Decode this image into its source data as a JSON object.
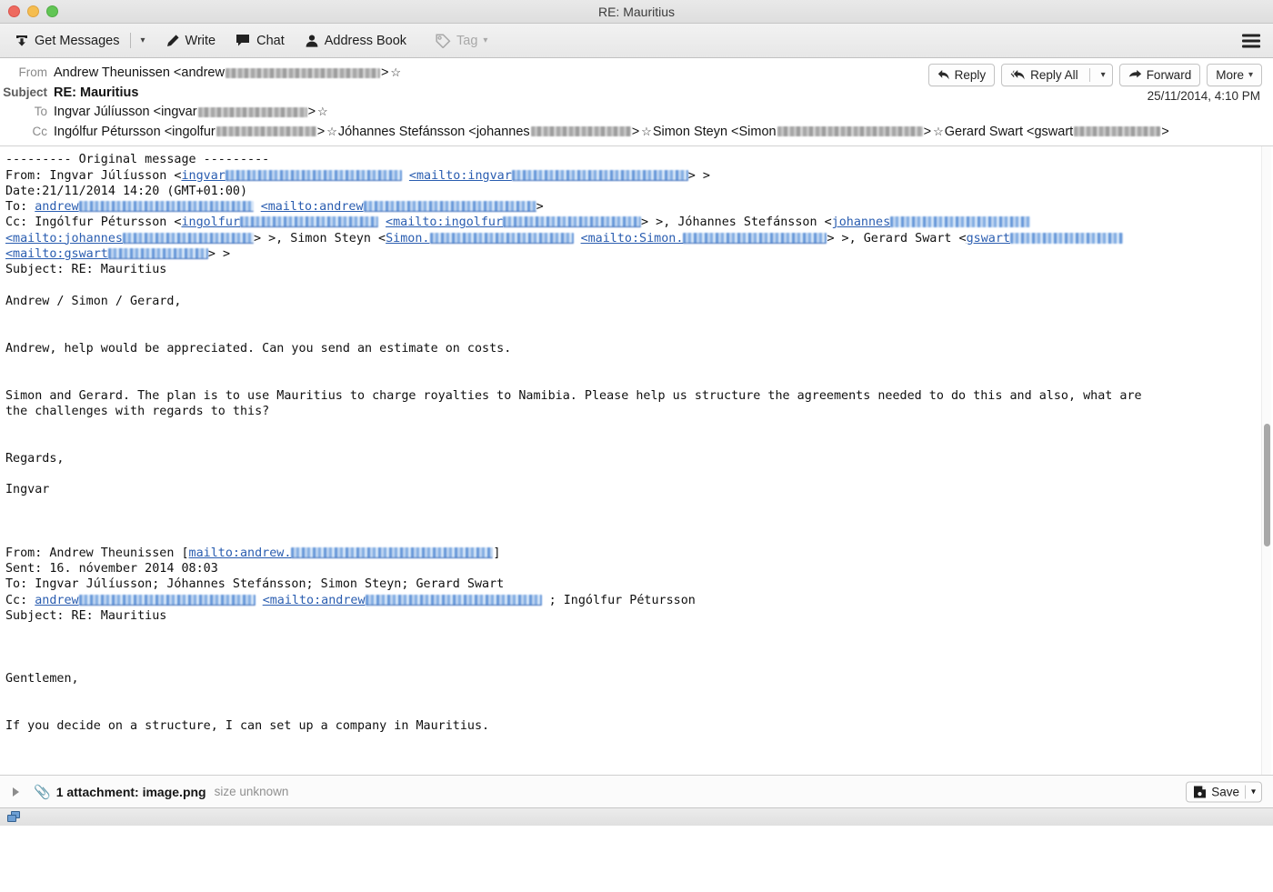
{
  "window": {
    "title": "RE: Mauritius",
    "traffic_lights": [
      "close",
      "minimize",
      "zoom"
    ]
  },
  "toolbar": {
    "get_messages": "Get Messages",
    "write": "Write",
    "chat": "Chat",
    "address_book": "Address Book",
    "tag": "Tag",
    "menu": "app-menu"
  },
  "message_header": {
    "from_label": "From",
    "from_value": "Andrew Theunissen <andrew",
    "from_value_end": ">",
    "subject_label": "Subject",
    "subject_value": "RE: Mauritius",
    "to_label": "To",
    "to_value": "Ingvar Júlíusson <ingvar",
    "to_value_end": ">",
    "cc_label": "Cc",
    "cc_parts": [
      {
        "name": "Ingólfur Pétursson <ingolfur",
        "end": ">"
      },
      {
        "name": "Jóhannes Stefánsson <johannes",
        "end": ">"
      },
      {
        "name": "Simon Steyn <Simon",
        "end": ">"
      },
      {
        "name": "Gerard Swart <gswart",
        "end": ">"
      }
    ],
    "timestamp": "25/11/2014, 4:10 PM"
  },
  "actions": {
    "reply": "Reply",
    "reply_all": "Reply All",
    "forward": "Forward",
    "more": "More"
  },
  "body": {
    "separator_line": "--------- Original message ---------",
    "quote1": {
      "from_prefix": "From: Ingvar Júlíusson <",
      "from_link1": "ingvar",
      "from_link2": "<mailto:ingvar",
      "from_suffix": "> >",
      "date": "Date:21/11/2014 14:20 (GMT+01:00)",
      "to_prefix": "To: ",
      "to_link1": "andrew",
      "to_link2": "<mailto:andrew",
      "to_suffix": ">",
      "cc_prefix": "Cc: Ingólfur Pétursson <",
      "cc_link1": "ingolfur",
      "cc_link2": "<mailto:ingolfur",
      "cc_mid1": "> >, Jóhannes Stefánsson <",
      "cc_link3": "johannes",
      "cc_link4": "<mailto:johannes",
      "cc_mid2": "> >, Simon Steyn <",
      "cc_link5": "Simon.",
      "cc_link6": "<mailto:Simon.",
      "cc_mid3": "> >, Gerard Swart <",
      "cc_link7": "gswart",
      "cc_link8": "<mailto:gswart",
      "cc_suffix": "> >",
      "subject": "Subject: RE: Mauritius",
      "greeting": "Andrew / Simon / Gerard,",
      "para1": "Andrew, help would be appreciated. Can you send an estimate on costs.",
      "para2_line1": "Simon and Gerard. The plan is to use Mauritius to charge royalties to Namibia. Please help us structure the agreements needed to do this and also, what are",
      "para2_line2": "the challenges with regards to this?",
      "signoff": "Regards,",
      "signature": "Ingvar"
    },
    "quote2": {
      "from_prefix": "From: Andrew Theunissen [",
      "from_link": "mailto:andrew.",
      "from_suffix": "]",
      "sent": "Sent: 16. nóvember 2014 08:03",
      "to": "To: Ingvar Júlíusson; Jóhannes Stefánsson; Simon Steyn; Gerard Swart",
      "cc_prefix": "Cc: ",
      "cc_link1": "andrew",
      "cc_link2": "<mailto:andrew",
      "cc_suffix": "; Ingólfur Pétursson",
      "subject": "Subject: RE: Mauritius",
      "greeting": "Gentlemen,",
      "para1": "If you decide on a structure, I can set up a company in Mauritius."
    }
  },
  "attachment_bar": {
    "twisty": "expand-triangle",
    "label": "1 attachment: image.png",
    "size": "size unknown",
    "save_label": "Save"
  },
  "status_bar": {
    "indicator": "network-activity-icon"
  },
  "colors": {
    "link": "#2a5db0",
    "redaction_blue": "#7aa7e0",
    "redaction_grey": "#9a9a9a",
    "toolbar_bg": "#ececec"
  }
}
